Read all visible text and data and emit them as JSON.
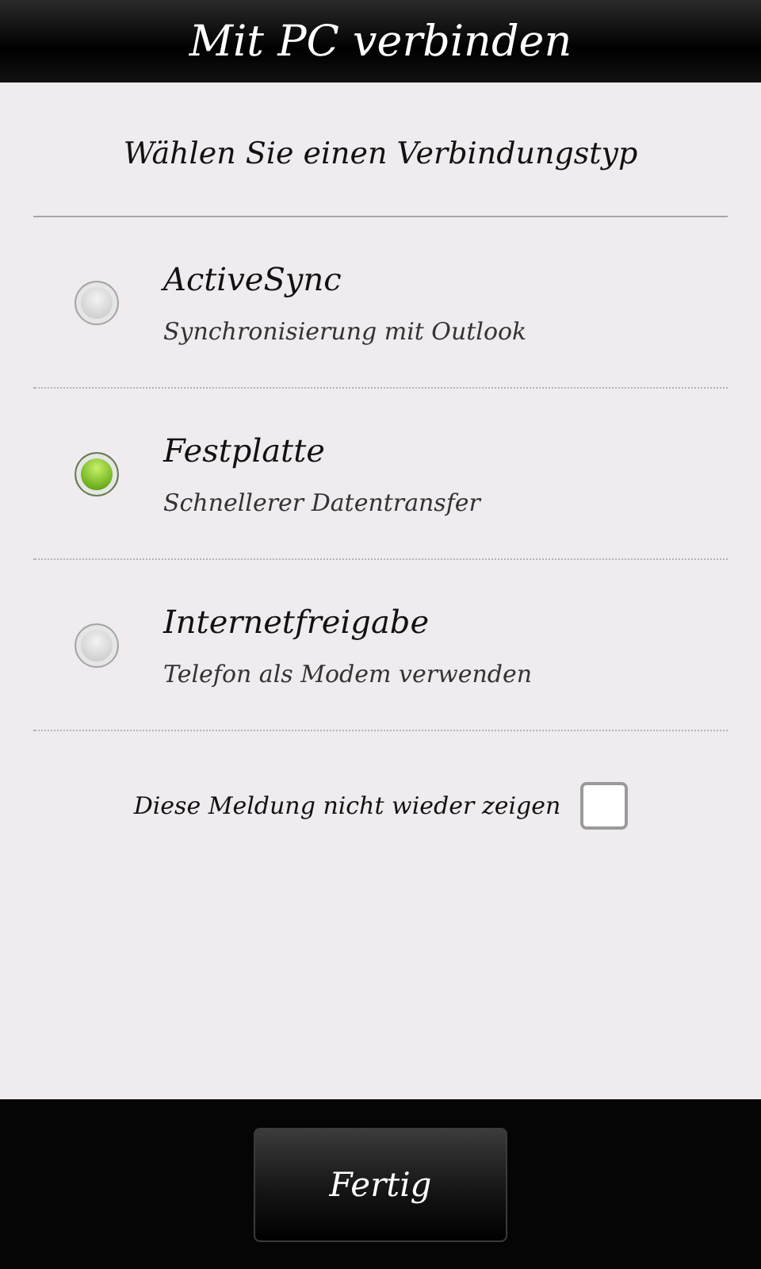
{
  "title_bar": {
    "title": "Mit PC verbinden"
  },
  "prompt": "Wählen Sie einen Verbindungstyp",
  "options": [
    {
      "label": "ActiveSync",
      "description": "Synchronisierung mit Outlook",
      "selected": false
    },
    {
      "label": "Festplatte",
      "description": "Schnellerer Datentransfer",
      "selected": true
    },
    {
      "label": "Internetfreigabe",
      "description": "Telefon als Modem verwenden",
      "selected": false
    }
  ],
  "dont_show_again": {
    "label": "Diese Meldung nicht wieder zeigen",
    "checked": false
  },
  "buttons": [
    {
      "label": "Fertig"
    }
  ]
}
